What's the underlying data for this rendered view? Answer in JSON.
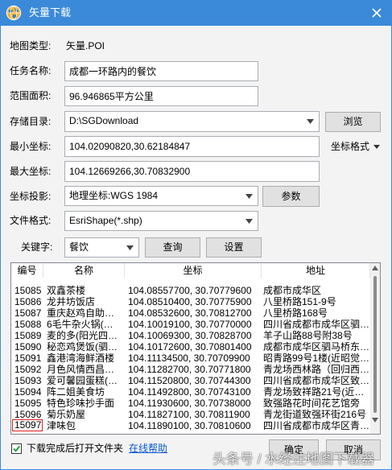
{
  "window": {
    "title": "矢量下载"
  },
  "form": {
    "map_type": {
      "label": "地图类型:",
      "value": "矢量.POI"
    },
    "task_name": {
      "label": "任务名称:",
      "value": "成都一环路内的餐饮"
    },
    "area": {
      "label": "范围面积:",
      "value": "96.946865平方公里"
    },
    "save_dir": {
      "label": "存储目录:",
      "value": "D:\\SGDownload",
      "browse_button": "浏览"
    },
    "min_coord": {
      "label": "最小坐标:",
      "value": "104.02090820,30.62184847"
    },
    "coord_format": {
      "label": "坐标格式"
    },
    "max_coord": {
      "label": "最大坐标:",
      "value": "104.12669266,30.70832900"
    },
    "projection": {
      "label": "坐标投影:",
      "value": "地理坐标:WGS 1984",
      "params_button": "参数"
    },
    "file_format": {
      "label": "文件格式:",
      "value": "EsriShape(*.shp)"
    },
    "keyword": {
      "label": "关键字:",
      "value": "餐饮",
      "query_button": "查询",
      "settings_button": "设置"
    }
  },
  "table": {
    "headers": [
      "编号",
      "名称",
      "坐标",
      "地址"
    ],
    "rows": [
      {
        "id": "15085",
        "name": "双鑫茶楼",
        "coord": "104.08557700, 30.70779600",
        "address": "成都市成华区"
      },
      {
        "id": "15086",
        "name": "龙井坊饭店",
        "coord": "104.08510400, 30.70775900",
        "address": "八里桥路151-9号"
      },
      {
        "id": "15087",
        "name": "重庆赵鸡自助…",
        "coord": "104.08532600, 30.70812700",
        "address": "八里桥路168号"
      },
      {
        "id": "15088",
        "name": "6毛牛杂火锅(…",
        "coord": "104.10019100, 30.70770000",
        "address": "四川省成都市成华区驷…"
      },
      {
        "id": "15089",
        "name": "麦的多(阳光四…",
        "coord": "104.10069300, 30.70828700",
        "address": "羊子山路88号附38号"
      },
      {
        "id": "15090",
        "name": "秘恋鸡煲饭(驷…",
        "coord": "104.10172600, 30.70801400",
        "address": "成都市成华区驷马桥东…"
      },
      {
        "id": "15091",
        "name": "鑫港湾海鲜酒楼",
        "coord": "104.11134500, 30.70709900",
        "address": "昭青路99号1楼(近昭觉…"
      },
      {
        "id": "15092",
        "name": "月色风情西昌…",
        "coord": "104.11282700, 30.70771800",
        "address": "青龙场西林路（回归西…"
      },
      {
        "id": "15093",
        "name": "爱可馨园蛋糕(…",
        "coord": "104.11520800, 30.70744300",
        "address": "四川省成都市成华区致…"
      },
      {
        "id": "15094",
        "name": "阵二姐美食坊",
        "coord": "104.11492800, 30.70743100",
        "address": "青龙场致祥路21号(近…"
      },
      {
        "id": "15095",
        "name": "特色珍味抄手面",
        "coord": "104.11930600, 30.70738000",
        "address": "致强路花时间花艺馆旁"
      },
      {
        "id": "15096",
        "name": "菊乐奶屋",
        "coord": "104.11827100, 30.70811900",
        "address": "青龙街道致强环街216号"
      },
      {
        "id": "15097",
        "name": "津味包",
        "coord": "104.11890100, 30.70810600",
        "address": "四川省成都市成华区青…",
        "selected": true
      }
    ]
  },
  "footer": {
    "open_folder_label": "下载完成后打开文件夹",
    "open_folder_checked": true,
    "help_link": "在线帮助",
    "ok_button": "确定",
    "cancel_button": "取消"
  },
  "watermark": "头条号 / 水经注地图下载器",
  "icons": {
    "app": "globe-icon",
    "close": "close-icon",
    "dropdown": "chevron-down-icon",
    "checkbox": "checkmark-icon"
  },
  "colors": {
    "title_bar": "#3b8ad9",
    "link": "#0b57d0",
    "selection_border": "#e02020",
    "checkmark": "#2e9e3e"
  }
}
